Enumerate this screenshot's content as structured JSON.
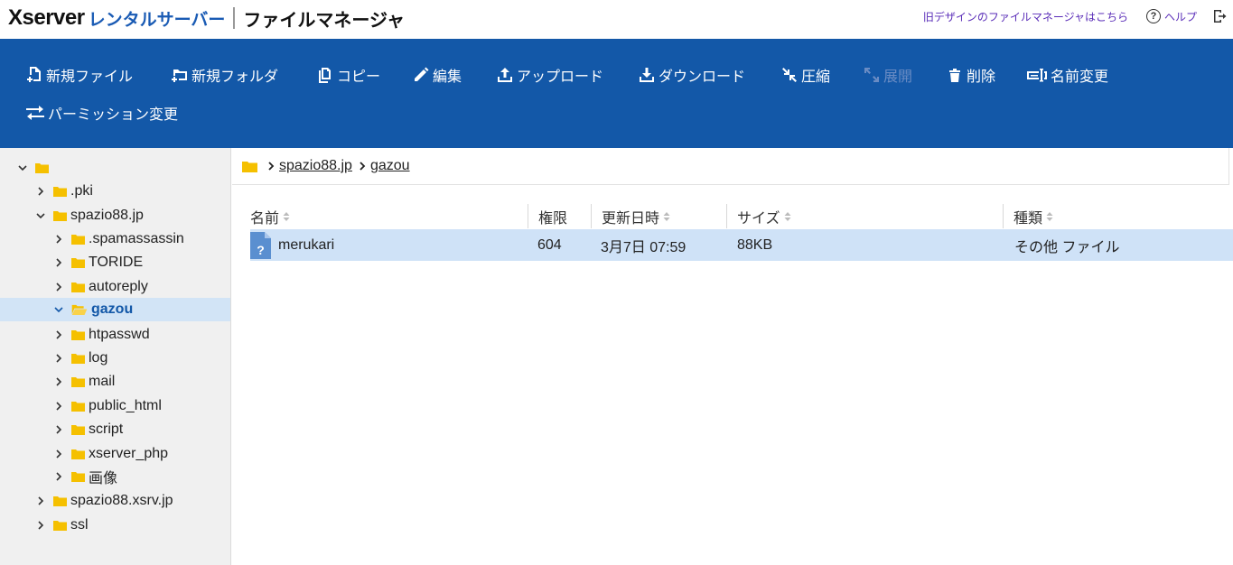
{
  "header": {
    "brand_x": "Xserver",
    "brand_rental": "レンタルサーバー",
    "app_title": "ファイルマネージャ",
    "old_design_link": "旧デザインのファイルマネージャはこちら",
    "help_label": "ヘルプ",
    "help_icon": "question-circle-icon",
    "logout_icon": "logout-icon"
  },
  "toolbar": {
    "new_file": "新規ファイル",
    "new_folder": "新規フォルダ",
    "copy": "コピー",
    "edit": "編集",
    "upload": "アップロード",
    "download": "ダウンロード",
    "compress": "圧縮",
    "extract": "展開",
    "delete": "削除",
    "rename": "名前変更",
    "permission": "パーミッション変更"
  },
  "tree": {
    "root": "",
    "items": [
      {
        "label": ".pki"
      },
      {
        "label": "spazio88.jp"
      },
      {
        "label": ".spamassassin"
      },
      {
        "label": "TORIDE"
      },
      {
        "label": "autoreply"
      },
      {
        "label": "gazou"
      },
      {
        "label": "htpasswd"
      },
      {
        "label": "log"
      },
      {
        "label": "mail"
      },
      {
        "label": "public_html"
      },
      {
        "label": "script"
      },
      {
        "label": "xserver_php"
      },
      {
        "label": "画像"
      },
      {
        "label": "spazio88.xsrv.jp"
      },
      {
        "label": "ssl"
      }
    ]
  },
  "breadcrumb": {
    "items": [
      "spazio88.jp",
      "gazou"
    ]
  },
  "table": {
    "columns": [
      "名前",
      "権限",
      "更新日時",
      "サイズ",
      "種類"
    ],
    "rows": [
      {
        "name": "merukari",
        "permission": "604",
        "modified": "3月7日 07:59",
        "size": "88KB",
        "type": "その他 ファイル"
      }
    ]
  },
  "colors": {
    "toolbar_bg": "#1358a8",
    "brand_blue": "#1a5bb4",
    "selection_bg": "#cfe2f7",
    "folder": "#f5c000"
  }
}
